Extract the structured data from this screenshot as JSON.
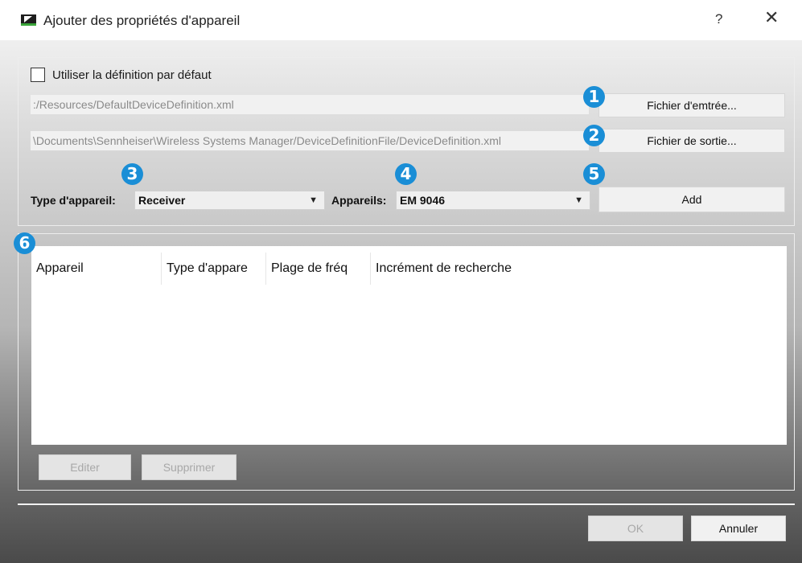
{
  "window": {
    "title": "Ajouter des propriétés d'appareil",
    "help_label": "?",
    "close_label": "✕"
  },
  "options": {
    "use_default_label": "Utiliser la définition par défaut",
    "use_default_checked": false
  },
  "files": {
    "input_path": ":/Resources/DefaultDeviceDefinition.xml",
    "input_button": "Fichier d'emtrée...",
    "output_path": "\\Documents\\Sennheiser\\Wireless Systems Manager/DeviceDefinitionFile/DeviceDefinition.xml",
    "output_button": "Fichier de sortie..."
  },
  "device": {
    "type_label": "Type d'appareil:",
    "type_value": "Receiver",
    "devices_label": "Appareils:",
    "devices_value": "EM 9046",
    "add_button": "Add"
  },
  "table": {
    "columns": [
      "Appareil",
      "Type d'appare",
      "Plage de fréq",
      "Incrément de recherche"
    ],
    "rows": []
  },
  "table_actions": {
    "edit_button": "Editer",
    "delete_button": "Supprimer"
  },
  "footer": {
    "ok_button": "OK",
    "cancel_button": "Annuler"
  },
  "callouts": [
    "1",
    "2",
    "3",
    "4",
    "5",
    "6"
  ],
  "colors": {
    "callout": "#1a8ed6",
    "brand_green": "#3aa53a"
  },
  "icons": {
    "app": "sennheiser-logo-icon",
    "close": "close-icon",
    "dropdown": "chevron-down-icon"
  }
}
